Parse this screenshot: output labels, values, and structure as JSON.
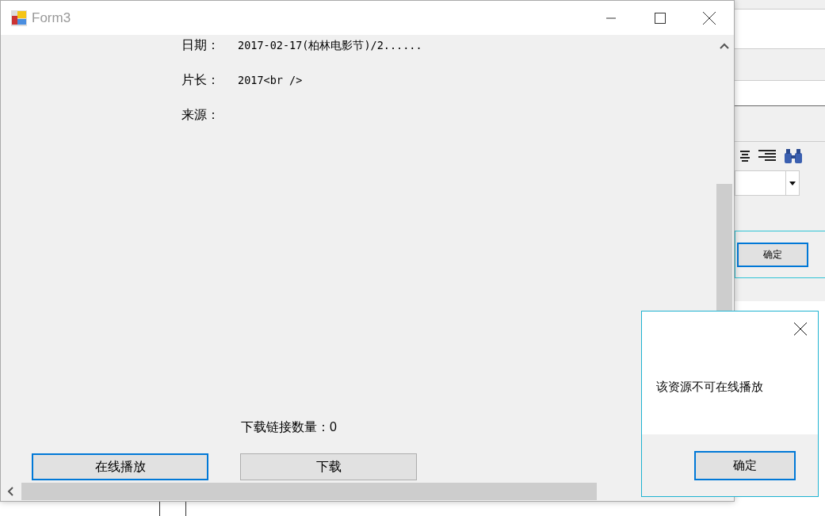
{
  "window": {
    "title": "Form3"
  },
  "fields": [
    {
      "label": "日期：",
      "value": "2017-02-17(柏林电影节)/2......"
    },
    {
      "label": "片长：",
      "value": "2017<br />"
    },
    {
      "label": "来源："
    }
  ],
  "download_count": "下载链接数量：0",
  "buttons": [
    {
      "label": "在线播放",
      "focused": true
    },
    {
      "label": "下载",
      "focused": false
    }
  ],
  "background_window": {
    "button": "确定"
  },
  "message_box": {
    "message": "该资源不可在线播放",
    "button": "确定"
  }
}
